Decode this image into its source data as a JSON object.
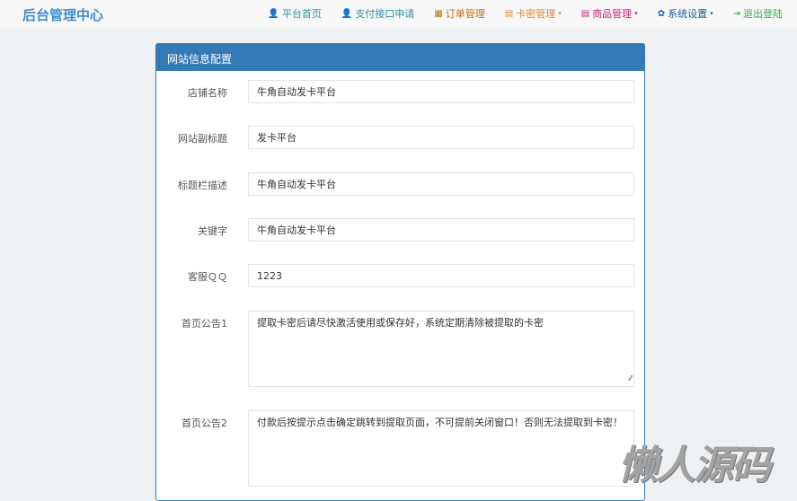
{
  "brand": "后台管理中心",
  "nav": [
    {
      "label": "平台首页",
      "icon": "user-icon",
      "glyph": "👤",
      "color": "#2f8fa0",
      "caret": false
    },
    {
      "label": "支付接口申请",
      "icon": "user-icon",
      "glyph": "👤",
      "color": "#2f8fa0",
      "caret": false
    },
    {
      "label": "订单管理",
      "icon": "calculator-icon",
      "glyph": "▦",
      "color": "#b8720c",
      "caret": false
    },
    {
      "label": "卡密管理",
      "icon": "list-icon",
      "glyph": "▤",
      "color": "#e0893a",
      "caret": true
    },
    {
      "label": "商品管理",
      "icon": "list-icon",
      "glyph": "▤",
      "color": "#c81d7a",
      "caret": true
    },
    {
      "label": "系统设置",
      "icon": "gear-icon",
      "glyph": "✿",
      "color": "#1f5fa0",
      "caret": true
    },
    {
      "label": "退出登陆",
      "icon": "logout-icon",
      "glyph": "⇥",
      "color": "#39ad47",
      "caret": false
    }
  ],
  "caret": "▾",
  "panel": {
    "title": "网站信息配置",
    "fields": [
      {
        "label": "店铺名称",
        "value": "牛角自动发卡平台"
      },
      {
        "label": "网站副标题",
        "value": "发卡平台"
      },
      {
        "label": "标题栏描述",
        "value": "牛角自动发卡平台"
      },
      {
        "label": "关键字",
        "value": "牛角自动发卡平台"
      },
      {
        "label": "客服ＱＱ",
        "value": "1223"
      }
    ],
    "textareas": [
      {
        "label": "首页公告1",
        "value": "提取卡密后请尽快激活使用或保存好，系统定期清除被提取的卡密"
      },
      {
        "label": "首页公告2",
        "value": "付款后按提示点击确定跳转到提取页面，不可提前关闭窗口！否则无法提取到卡密！"
      }
    ]
  },
  "watermark": "懒人源码"
}
